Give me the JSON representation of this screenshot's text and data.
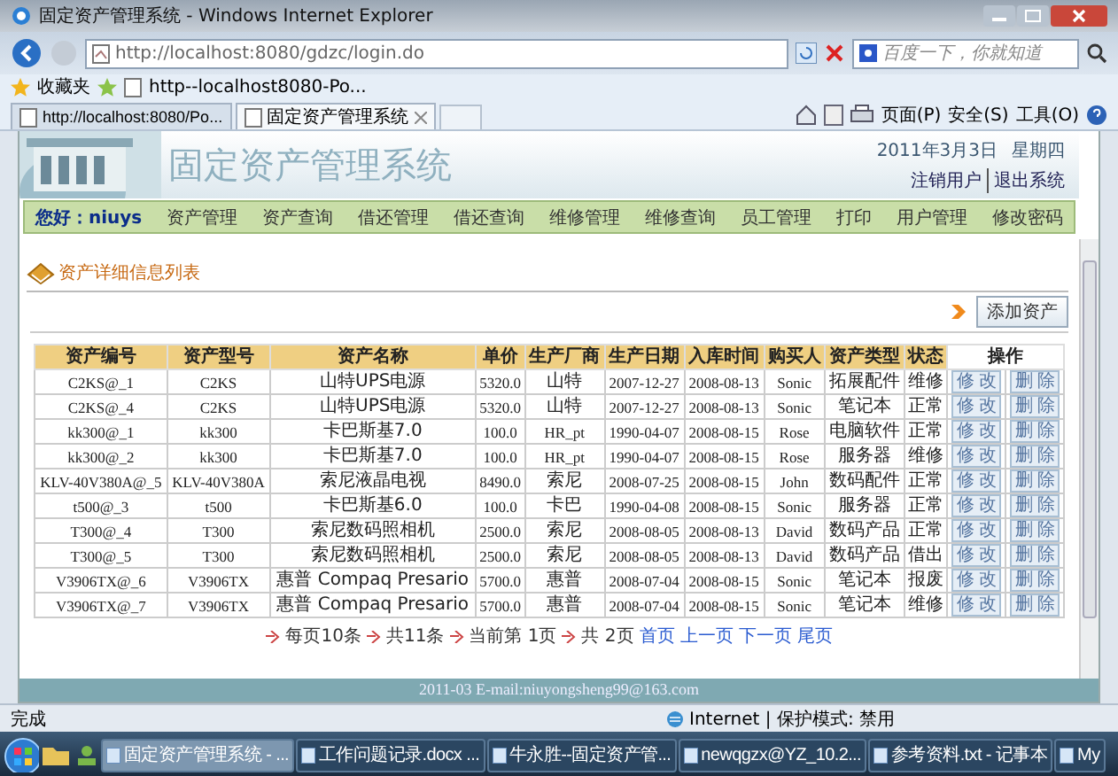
{
  "window": {
    "title": "固定资产管理系统 - Windows Internet Explorer"
  },
  "browser": {
    "address": "http://localhost:8080/gdzc/login.do",
    "search_placeholder": "百度一下，你就知道",
    "favorites_label": "收藏夹",
    "favorites_link": "http--localhost8080-Po...",
    "tabs": [
      {
        "label": "http://localhost:8080/Po...",
        "selected": false
      },
      {
        "label": "固定资产管理系统",
        "selected": true
      }
    ],
    "commands": [
      "页面(P)",
      "安全(S)",
      "工具(O)"
    ]
  },
  "header": {
    "title": "固定资产管理系统",
    "date": "2011年3月3日",
    "weekday": "星期四",
    "links": [
      "注销用户",
      "退出系统"
    ]
  },
  "nav": {
    "greeting": "您好：niuys",
    "items": [
      "资产管理",
      "资产查询",
      "借还管理",
      "借还查询",
      "维修管理",
      "维修查询",
      "员工管理",
      "打印",
      "用户管理",
      "修改密码"
    ]
  },
  "section_title": "资产详细信息列表",
  "add_button": "添加资产",
  "table": {
    "columns": [
      "资产编号",
      "资产型号",
      "资产名称",
      "单价",
      "生产厂商",
      "生产日期",
      "入库时间",
      "购买人",
      "资产类型",
      "状态",
      "操作"
    ],
    "rows": [
      {
        "cells": [
          "C2KS@_1",
          "C2KS",
          "山特UPS电源",
          "5320.0",
          "山特",
          "2007-12-27",
          "2008-08-13",
          "Sonic",
          "拓展配件",
          "维修"
        ],
        "actions": [
          "修 改",
          "删 除"
        ]
      },
      {
        "cells": [
          "C2KS@_4",
          "C2KS",
          "山特UPS电源",
          "5320.0",
          "山特",
          "2007-12-27",
          "2008-08-13",
          "Sonic",
          "笔记本",
          "正常"
        ],
        "actions": [
          "修 改",
          "删 除"
        ]
      },
      {
        "cells": [
          "kk300@_1",
          "kk300",
          "卡巴斯基7.0",
          "100.0",
          "HR_pt",
          "1990-04-07",
          "2008-08-15",
          "Rose",
          "电脑软件",
          "正常"
        ],
        "actions": [
          "修 改",
          "删 除"
        ]
      },
      {
        "cells": [
          "kk300@_2",
          "kk300",
          "卡巴斯基7.0",
          "100.0",
          "HR_pt",
          "1990-04-07",
          "2008-08-15",
          "Rose",
          "服务器",
          "维修"
        ],
        "actions": [
          "修 改",
          "删 除"
        ]
      },
      {
        "cells": [
          "KLV-40V380A@_5",
          "KLV-40V380A",
          "索尼液晶电视",
          "8490.0",
          "索尼",
          "2008-07-25",
          "2008-08-15",
          "John",
          "数码配件",
          "正常"
        ],
        "actions": [
          "修 改",
          "删 除"
        ]
      },
      {
        "cells": [
          "t500@_3",
          "t500",
          "卡巴斯基6.0",
          "100.0",
          "卡巴",
          "1990-04-08",
          "2008-08-15",
          "Sonic",
          "服务器",
          "正常"
        ],
        "actions": [
          "修 改",
          "删 除"
        ]
      },
      {
        "cells": [
          "T300@_4",
          "T300",
          "索尼数码照相机",
          "2500.0",
          "索尼",
          "2008-08-05",
          "2008-08-13",
          "David",
          "数码产品",
          "正常"
        ],
        "actions": [
          "修 改",
          "删 除"
        ]
      },
      {
        "cells": [
          "T300@_5",
          "T300",
          "索尼数码照相机",
          "2500.0",
          "索尼",
          "2008-08-05",
          "2008-08-13",
          "David",
          "数码产品",
          "借出"
        ],
        "actions": [
          "修 改",
          "删 除"
        ]
      },
      {
        "cells": [
          "V3906TX@_6",
          "V3906TX",
          "惠普 Compaq Presario",
          "5700.0",
          "惠普",
          "2008-07-04",
          "2008-08-15",
          "Sonic",
          "笔记本",
          "报废"
        ],
        "actions": [
          "修 改",
          "删 除"
        ]
      },
      {
        "cells": [
          "V3906TX@_7",
          "V3906TX",
          "惠普 Compaq Presario",
          "5700.0",
          "惠普",
          "2008-07-04",
          "2008-08-15",
          "Sonic",
          "笔记本",
          "维修"
        ],
        "actions": [
          "修 改",
          "删 除"
        ]
      }
    ]
  },
  "pagination": [
    {
      "kind": "text",
      "label": "每页10条"
    },
    {
      "kind": "text",
      "label": "共11条"
    },
    {
      "kind": "text",
      "label": "当前第 1页"
    },
    {
      "kind": "text",
      "label": "共 2页"
    },
    {
      "kind": "link",
      "label": "首页"
    },
    {
      "kind": "link",
      "label": "上一页"
    },
    {
      "kind": "link",
      "label": "下一页"
    },
    {
      "kind": "link",
      "label": "尾页"
    }
  ],
  "footer": "2011-03 E-mail:niuyongsheng99@163.com",
  "status_bar": {
    "status": "完成",
    "zone": "Internet | 保护模式: 禁用"
  },
  "taskbar": [
    {
      "label": "固定资产管理系统 - ...",
      "selected": true
    },
    {
      "label": "工作问题记录.docx ...",
      "selected": false
    },
    {
      "label": "牛永胜--固定资产管...",
      "selected": false
    },
    {
      "label": "newqgzx@YZ_10.2...",
      "selected": false
    },
    {
      "label": "参考资料.txt - 记事本",
      "selected": false
    },
    {
      "label": "My",
      "selected": false
    }
  ]
}
